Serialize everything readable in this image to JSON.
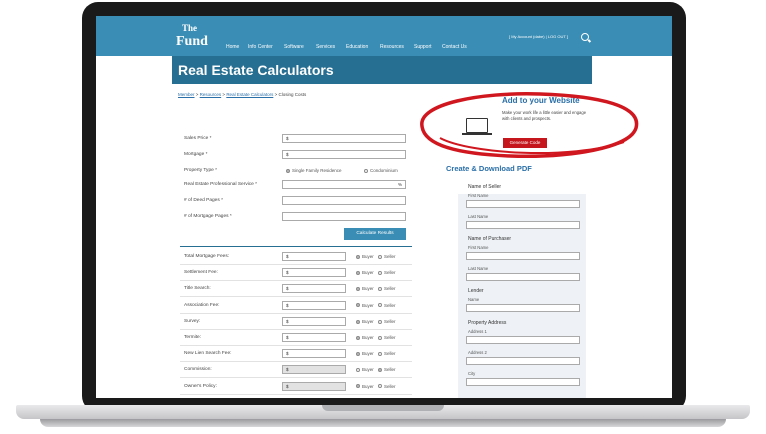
{
  "nav": {
    "logo_the": "The",
    "logo_fund": "Fund",
    "items": [
      "Home",
      "Info Center",
      "Software",
      "Services",
      "Education",
      "Resources",
      "Support",
      "Contact Us"
    ],
    "account": "[ My Account (dabe) | LOG OUT ]"
  },
  "page": {
    "title": "Real Estate Calculators",
    "breadcrumb": [
      "Member",
      "Resources",
      "Real Estate Calculators",
      "Closing Costs"
    ]
  },
  "form": {
    "sales_price": {
      "label": "Sales Price *",
      "prefix": "$"
    },
    "mortgage": {
      "label": "Mortgage *",
      "prefix": "$"
    },
    "property_type": {
      "label": "Property Type *",
      "options": [
        "Single Family Residence",
        "Condominium"
      ],
      "selected": "Single Family Residence"
    },
    "professional_service": {
      "label": "Real Estate Professional Service *",
      "suffix": "%"
    },
    "deed_pages": {
      "label": "# of Deed Pages *"
    },
    "mortgage_pages": {
      "label": "# of Mortgage Pages *"
    },
    "calculate_label": "Calculate Results"
  },
  "fees": [
    {
      "label": "Total Mortgage Fees:",
      "value": "$",
      "payer": "Buyer",
      "disabled": false
    },
    {
      "label": "Settlement Fee:",
      "value": "$",
      "payer": "Buyer",
      "disabled": false
    },
    {
      "label": "Title Search:",
      "value": "$",
      "payer": "Buyer",
      "disabled": false
    },
    {
      "label": "Association Fee:",
      "value": "$",
      "payer": "Buyer",
      "disabled": false
    },
    {
      "label": "Survey:",
      "value": "$",
      "payer": "Buyer",
      "disabled": false
    },
    {
      "label": "Termite:",
      "value": "$",
      "payer": "Buyer",
      "disabled": false
    },
    {
      "label": "New Lien Search Fee:",
      "value": "$",
      "payer": "Buyer",
      "disabled": false
    },
    {
      "label": "Commission:",
      "value": "$",
      "payer": "Seller",
      "disabled": true
    },
    {
      "label": "Owner's Policy:",
      "value": "$",
      "payer": "Buyer",
      "disabled": true
    },
    {
      "label": "Lenders Policy:",
      "value": "$",
      "payer": "Buyer",
      "disabled": true
    }
  ],
  "payer_options": [
    "Buyer",
    "Seller"
  ],
  "promo": {
    "title": "Add to your Website",
    "subtitle": "Make your work life a little easier and engage with clients and prospects.",
    "button": "Generate Code"
  },
  "pdf": {
    "title": "Create & Download PDF",
    "seller_heading": "Name of Seller",
    "first_name": "First Name",
    "last_name": "Last Name",
    "purchaser_heading": "Name of Purchaser",
    "lender_heading": "Lender",
    "name": "Name",
    "address_heading": "Property Address",
    "address1": "Address 1",
    "address2": "Address 2",
    "city": "City"
  },
  "colors": {
    "nav": "#3a8db5",
    "banner": "#276f92",
    "accent_red": "#c4161c"
  }
}
